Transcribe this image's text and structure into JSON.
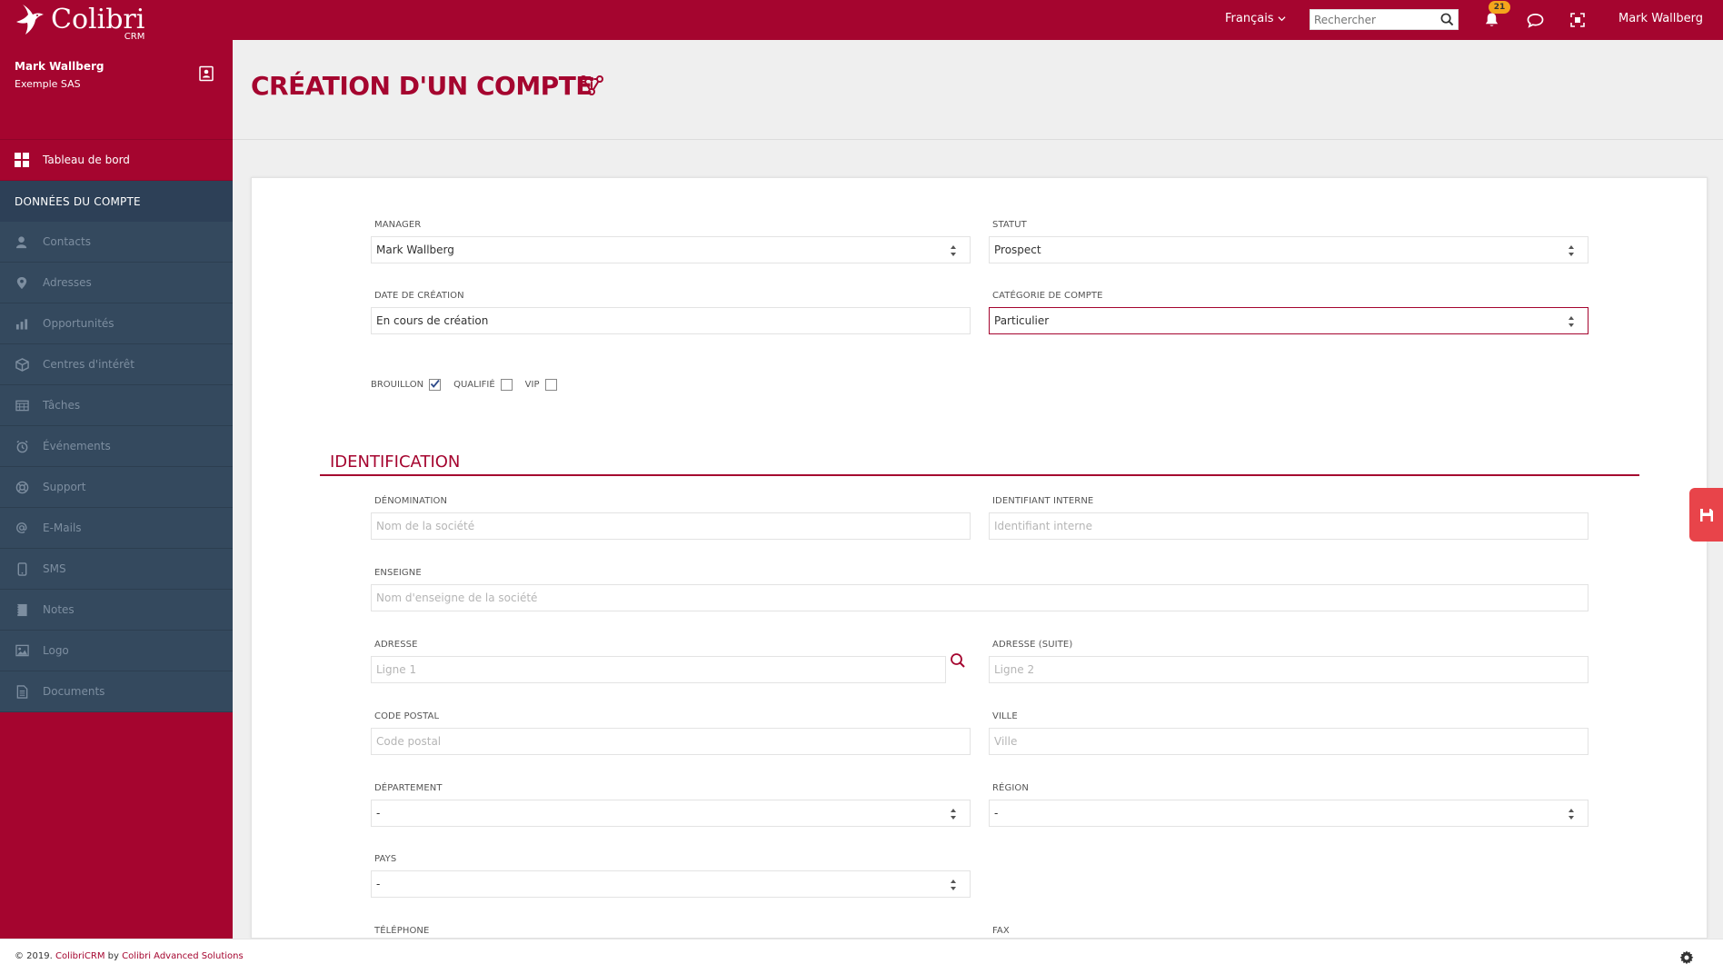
{
  "app": {
    "logo_name": "Colibri",
    "logo_sub": "CRM"
  },
  "topbar": {
    "language": "Français",
    "search_placeholder": "Rechercher",
    "notifications_count": "21",
    "user_name": "Mark Wallberg"
  },
  "sidebar": {
    "profile_name": "Mark Wallberg",
    "profile_company": "Exemple SAS",
    "dashboard_label": "Tableau de bord",
    "section_label": "DONNÉES DU COMPTE",
    "items": [
      {
        "label": "Contacts",
        "icon": "user-icon"
      },
      {
        "label": "Adresses",
        "icon": "map-pin-icon"
      },
      {
        "label": "Opportunités",
        "icon": "chart-icon"
      },
      {
        "label": "Centres d'intérêt",
        "icon": "box-icon"
      },
      {
        "label": "Tâches",
        "icon": "calendar-icon"
      },
      {
        "label": "Événements",
        "icon": "alarm-icon"
      },
      {
        "label": "Support",
        "icon": "lifebuoy-icon"
      },
      {
        "label": "E-Mails",
        "icon": "at-icon"
      },
      {
        "label": "SMS",
        "icon": "mobile-icon"
      },
      {
        "label": "Notes",
        "icon": "notes-icon"
      },
      {
        "label": "Logo",
        "icon": "image-icon"
      },
      {
        "label": "Documents",
        "icon": "document-icon"
      }
    ]
  },
  "page": {
    "title": "CRÉATION D'UN COMPTE"
  },
  "form": {
    "manager_label": "MANAGER",
    "manager_value": "Mark Wallberg",
    "statut_label": "STATUT",
    "statut_value": "Prospect",
    "date_label": "DATE DE CRÉATION",
    "date_value": "En cours de création",
    "categorie_label": "CATÉGORIE DE COMPTE",
    "categorie_value": "Particulier",
    "checks": {
      "brouillon_label": "BROUILLON",
      "brouillon_checked": true,
      "qualifie_label": "QUALIFIÉ",
      "qualifie_checked": false,
      "vip_label": "VIP",
      "vip_checked": false
    },
    "section_identification": "IDENTIFICATION",
    "denomination_label": "DÉNOMINATION",
    "denomination_placeholder": "Nom de la société",
    "identifiant_label": "IDENTIFIANT INTERNE",
    "identifiant_placeholder": "Identifiant interne",
    "enseigne_label": "ENSEIGNE",
    "enseigne_placeholder": "Nom d'enseigne de la société",
    "adresse_label": "ADRESSE",
    "adresse_placeholder": "Ligne 1",
    "adresse_suite_label": "ADRESSE (SUITE)",
    "adresse_suite_placeholder": "Ligne 2",
    "cp_label": "CODE POSTAL",
    "cp_placeholder": "Code postal",
    "ville_label": "VILLE",
    "ville_placeholder": "Ville",
    "departement_label": "DÉPARTEMENT",
    "departement_value": "-",
    "region_label": "RÉGION",
    "region_value": "-",
    "pays_label": "PAYS",
    "pays_value": "-",
    "telephone_label": "TÉLÉPHONE",
    "fax_label": "FAX"
  },
  "footer": {
    "copyright": "© 2019.",
    "link": "ColibriCRM",
    "by": "by",
    "company": "Colibri Advanced Solutions"
  },
  "colors": {
    "brand": "#a5052f",
    "sidebar_dark": "#34495e",
    "save": "#e8444a",
    "badge": "#f4a51c"
  }
}
